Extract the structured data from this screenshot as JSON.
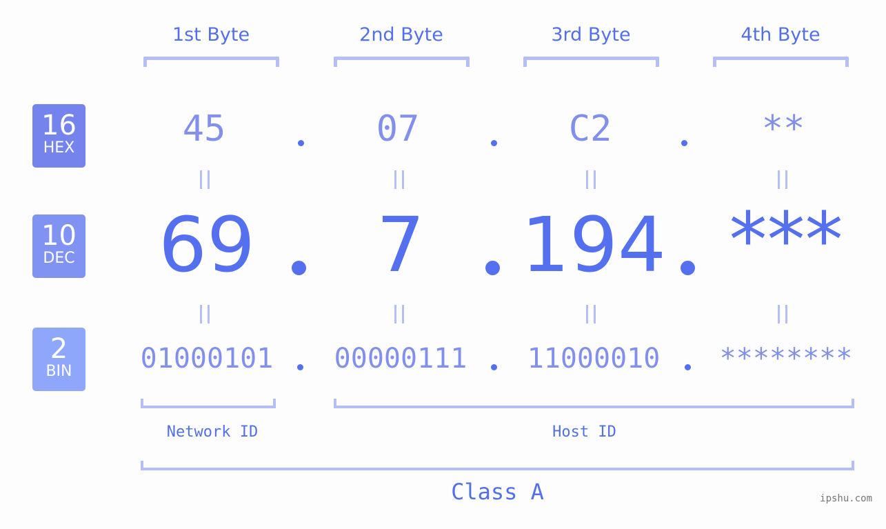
{
  "bytes": {
    "headers": [
      "1st Byte",
      "2nd Byte",
      "3rd Byte",
      "4th Byte"
    ]
  },
  "bases": {
    "hex": {
      "number": "16",
      "label": "HEX",
      "color": "#7484ec"
    },
    "dec": {
      "number": "10",
      "label": "DEC",
      "color": "#8193f2"
    },
    "bin": {
      "number": "2",
      "label": "BIN",
      "color": "#8fa7fa"
    }
  },
  "values": {
    "hex": [
      "45",
      "07",
      "C2",
      "**"
    ],
    "dec": [
      "69",
      "7",
      "194",
      "***"
    ],
    "bin": [
      "01000101",
      "00000111",
      "11000010",
      "********"
    ]
  },
  "segments": {
    "network_id": "Network ID",
    "host_id": "Host ID",
    "class": "Class A"
  },
  "colors": {
    "primary": "#5470ee",
    "secondary": "#8290eb",
    "bracket": "#b6bff5"
  },
  "watermark": "ipshu.com"
}
